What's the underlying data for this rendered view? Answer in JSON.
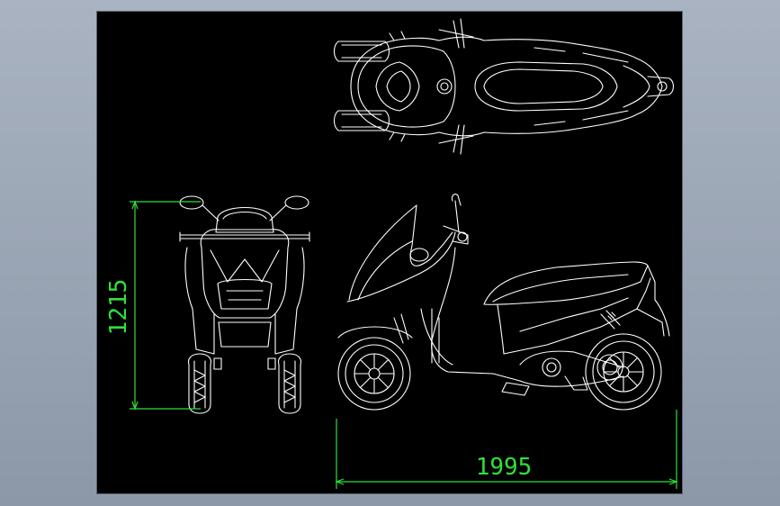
{
  "colors": {
    "background": "#8c97a8",
    "viewport": "#000000",
    "linework": "#ffffff",
    "dimension": "#2fe03a"
  },
  "dimensions": {
    "height_value": "1215",
    "length_value": "1995"
  },
  "views": [
    "top-view",
    "front-view",
    "side-view"
  ]
}
